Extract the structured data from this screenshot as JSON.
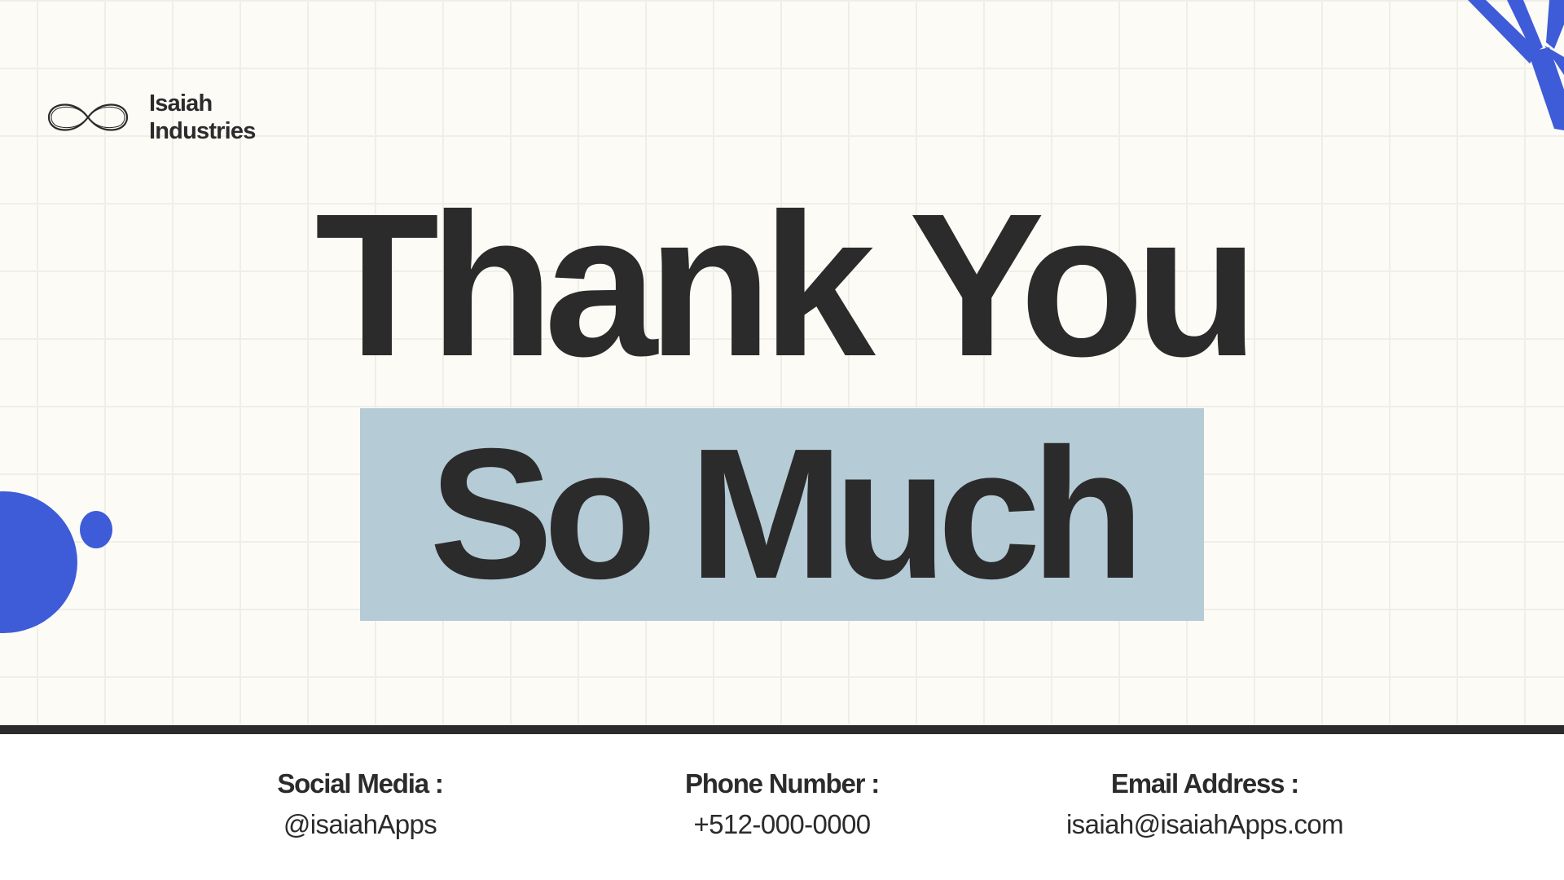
{
  "brand": {
    "logo_icon": "infinity-icon",
    "name_line1": "Isaiah",
    "name_line2": "Industries"
  },
  "headline": {
    "line1": "Thank You",
    "line2": "So Much"
  },
  "contacts": [
    {
      "label": "Social Media :",
      "value": "@isaiahApps"
    },
    {
      "label": "Phone Number :",
      "value": "+512-000-0000"
    },
    {
      "label": "Email Address :",
      "value": "isaiah@isaiahApps.com"
    }
  ],
  "colors": {
    "background": "#fcfbf6",
    "text": "#2b2b2b",
    "accent_blue": "#3e5bd8",
    "highlight": "#b5cbd6"
  }
}
